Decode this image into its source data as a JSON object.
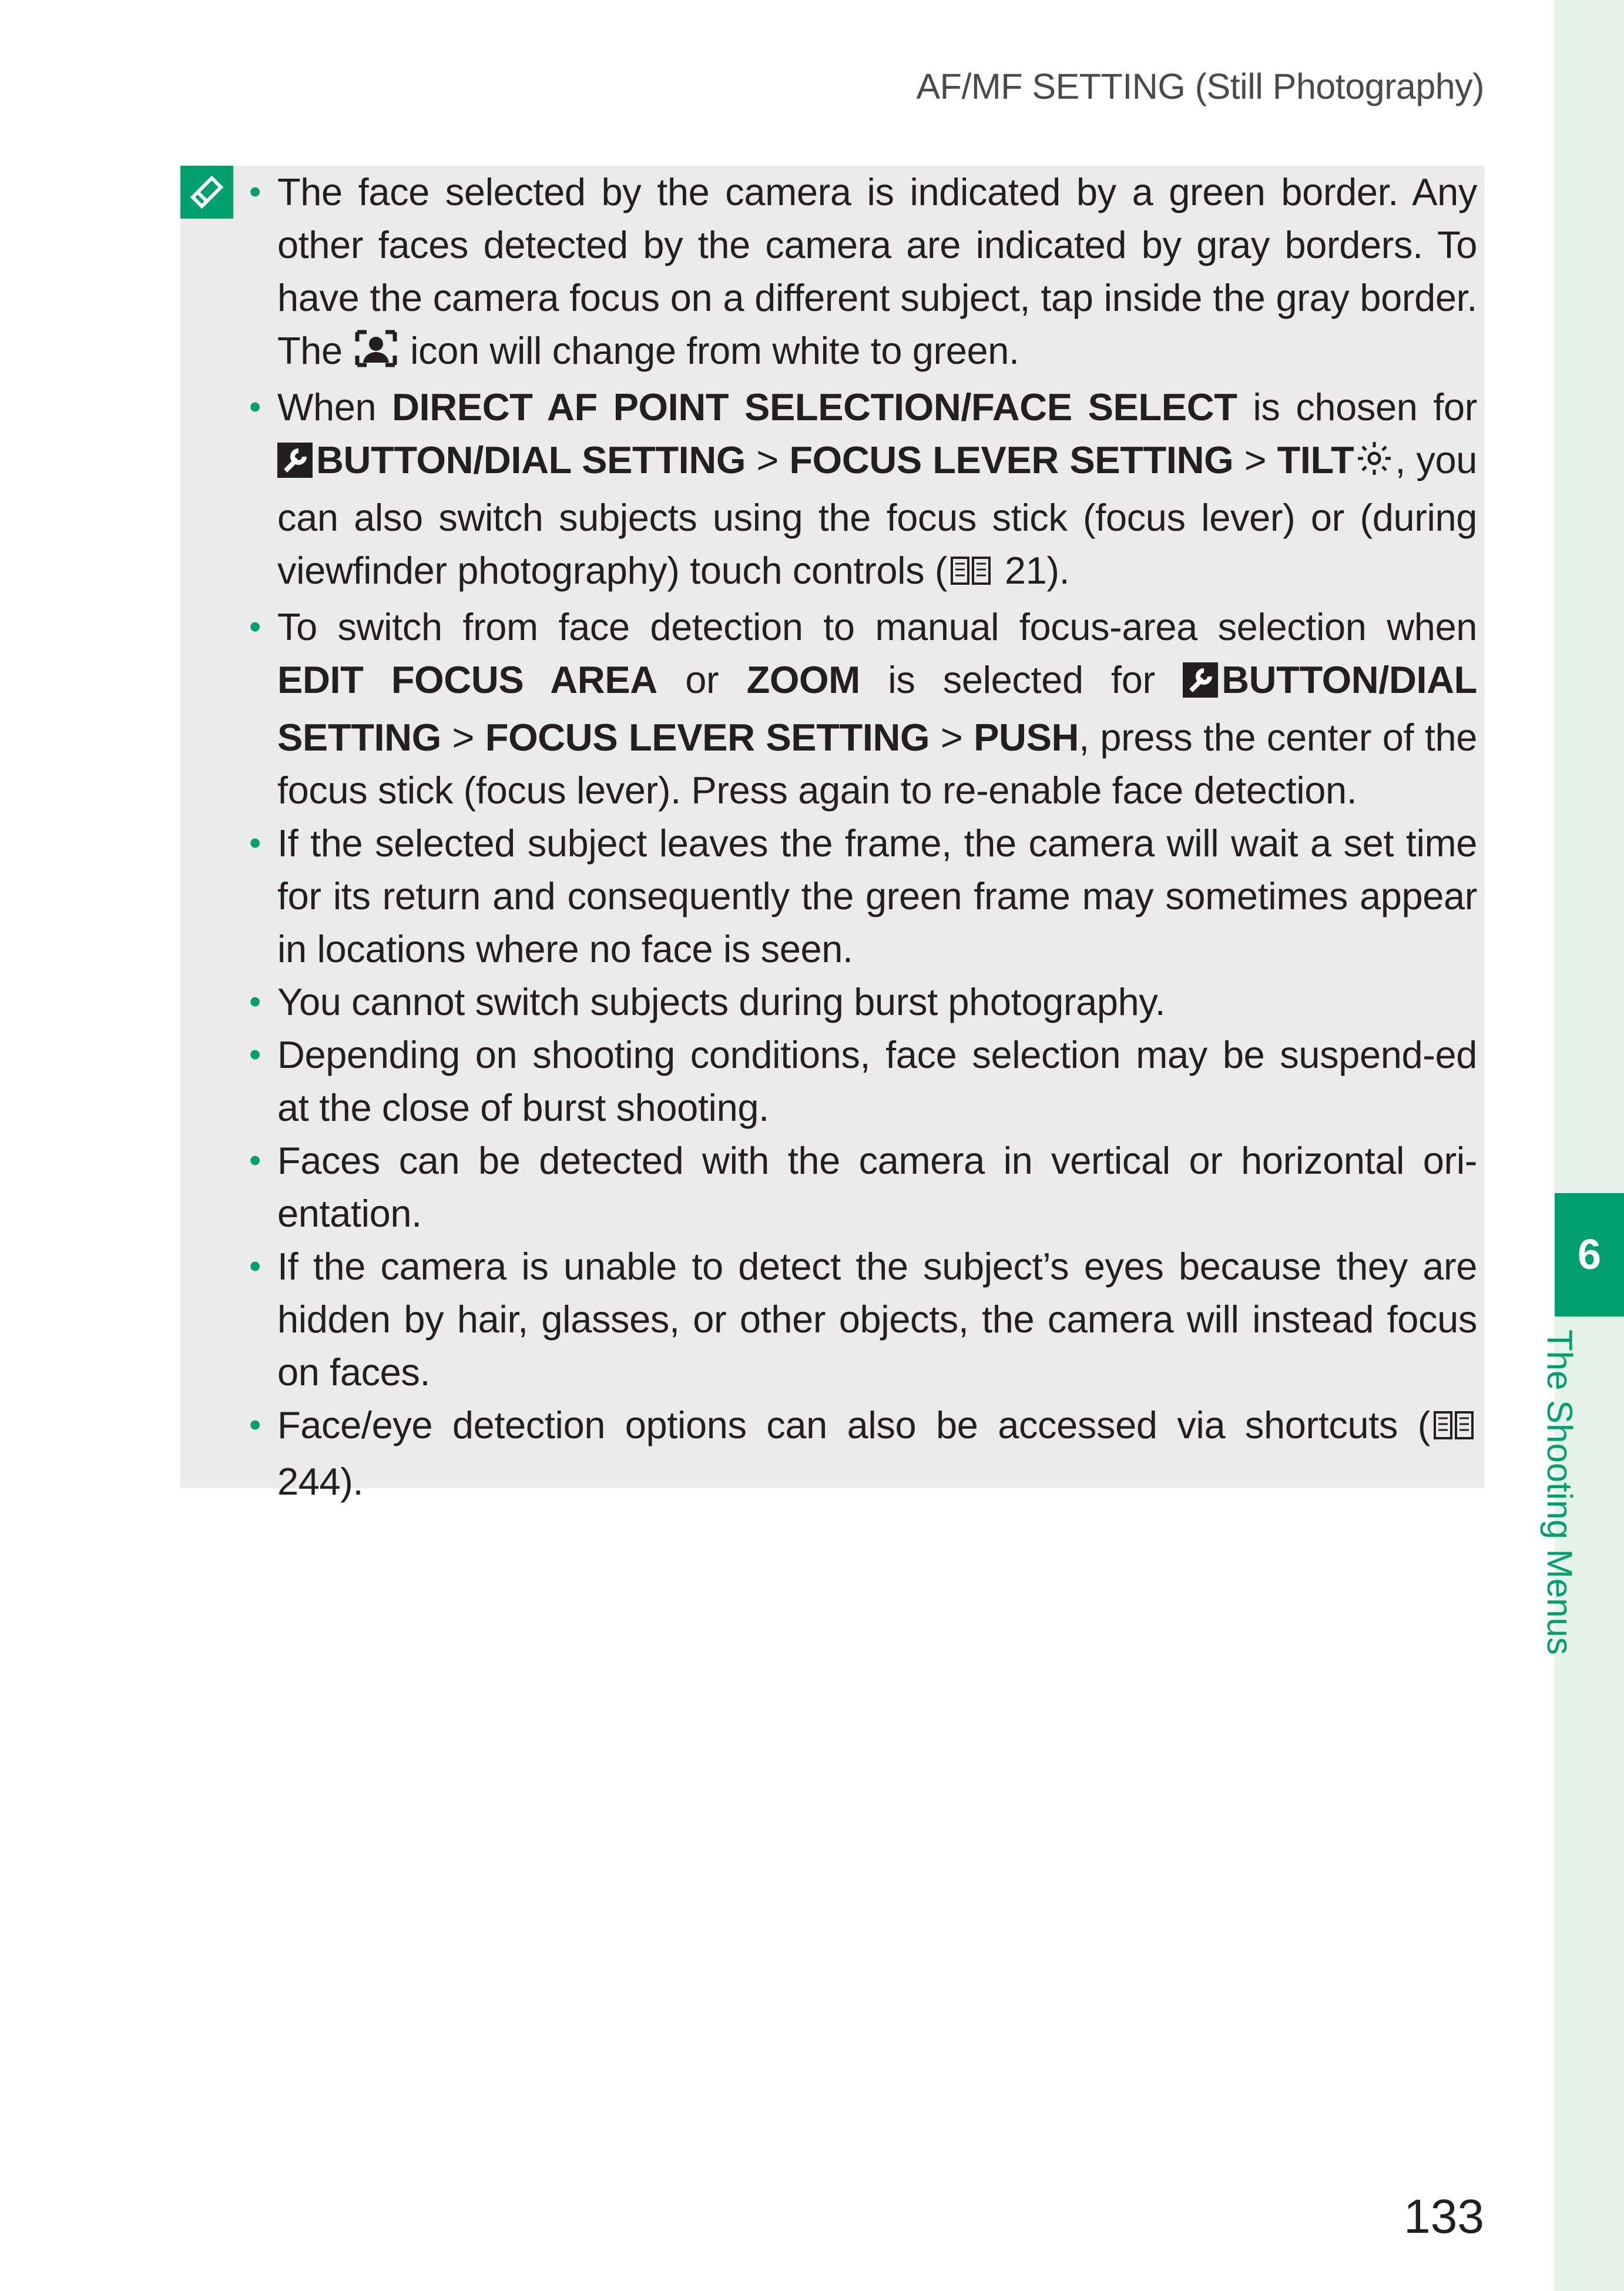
{
  "header": {
    "title": "AF/MF SETTING (Still Photography)"
  },
  "note": {
    "icon": "memo-pencil-icon",
    "items": [
      {
        "runs": [
          {
            "t": "The face selected by the camera is indicated by a green border. Any other faces detected by the camera are indicated by gray borders. To have the camera focus on a different subject, tap inside the gray border. The "
          },
          {
            "icon": "face-select-icon"
          },
          {
            "t": " icon will change from white to green."
          }
        ]
      },
      {
        "runs": [
          {
            "t": "When "
          },
          {
            "b": "DIRECT AF POINT SELECTION/FACE SELECT"
          },
          {
            "t": " is chosen for "
          },
          {
            "icon": "wrench-settings-icon"
          },
          {
            "b": "BUTTON/DIAL SETTING"
          },
          {
            "t": " > "
          },
          {
            "b": "FOCUS LEVER SETTING"
          },
          {
            "t": " > "
          },
          {
            "b": "TILT"
          },
          {
            "icon": "tilt-stick-icon"
          },
          {
            "t": ", you can also switch subjects using the focus stick (focus lever) or (during viewfinder photography) touch controls ("
          },
          {
            "icon": "book-reference-icon"
          },
          {
            "t": " 21)."
          }
        ]
      },
      {
        "runs": [
          {
            "t": "To switch from face detection to manual focus-area selection when "
          },
          {
            "b": "EDIT FOCUS AREA"
          },
          {
            "t": " or "
          },
          {
            "b": "ZOOM"
          },
          {
            "t": " is selected for "
          },
          {
            "icon": "wrench-settings-icon"
          },
          {
            "b": "BUTTON/DIAL SETTING"
          },
          {
            "t": " > "
          },
          {
            "b": "FOCUS LEVER SETTING"
          },
          {
            "t": " > "
          },
          {
            "b": "PUSH"
          },
          {
            "t": ", press the center of the focus stick (focus lever). Press again to re-enable face detection."
          }
        ]
      },
      {
        "runs": [
          {
            "t": "If the selected subject leaves the frame, the camera will wait a set time for its return and consequently the green frame may sometimes appear in locations where no face is seen."
          }
        ]
      },
      {
        "runs": [
          {
            "t": "You cannot switch subjects during burst photography."
          }
        ]
      },
      {
        "runs": [
          {
            "t": "Depending on shooting conditions, face selection may be suspend-ed at the close of burst shooting."
          }
        ]
      },
      {
        "runs": [
          {
            "t": "Faces can be detected with the camera in vertical or horizontal ori-entation."
          }
        ]
      },
      {
        "runs": [
          {
            "t": "If the camera is unable to detect the subject’s eyes because they are hidden by hair, glasses, or other objects, the camera will instead focus on faces."
          }
        ]
      },
      {
        "runs": [
          {
            "t": "Face/eye detection options can also be accessed via shortcuts ("
          },
          {
            "icon": "book-reference-icon"
          },
          {
            "t": " 244)."
          }
        ]
      }
    ]
  },
  "sidebar": {
    "chapter_number": "6",
    "chapter_title": "The Shooting Menus"
  },
  "footer": {
    "page_number": "133"
  },
  "colors": {
    "accent": "#00a06e",
    "note_bg": "#ebebeb",
    "tab_bg": "#e6f3ec"
  }
}
